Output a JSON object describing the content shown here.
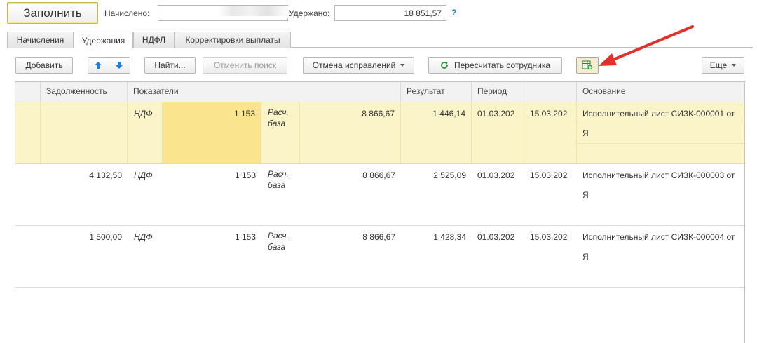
{
  "top": {
    "fill_button": "Заполнить",
    "accrued_label": "Начислено:",
    "accrued_value": "",
    "withheld_label": "Удержано:",
    "withheld_value": "18 851,57",
    "help_mark": "?"
  },
  "tabs": [
    {
      "label": "Начисления",
      "active": false
    },
    {
      "label": "Удержания",
      "active": true
    },
    {
      "label": "НДФЛ",
      "active": false
    },
    {
      "label": "Корректировки выплаты",
      "active": false
    }
  ],
  "toolbar": {
    "add": "Добавить",
    "find": "Найти...",
    "cancel_search": "Отменить поиск",
    "cancel_corrections": "Отмена исправлений",
    "recalc": "Пересчитать сотрудника",
    "more": "Еще"
  },
  "grid": {
    "columns": [
      "Задолженность",
      "Показатели",
      "Результат",
      "Период",
      "",
      "Основание"
    ],
    "rows": [
      {
        "debt": "",
        "ind_name": "НДФ",
        "ind_value": "1 153",
        "ind_name2": "Расч. база",
        "ind_value2": "8 866,67",
        "result": "1 446,14",
        "period_from": "01.03.202",
        "period_to": "15.03.202",
        "basis": "Исполнительный лист СИЗК-000001 от",
        "basis2": "Я"
      },
      {
        "debt": "4 132,50",
        "ind_name": "НДФ",
        "ind_value": "1 153",
        "ind_name2": "Расч. база",
        "ind_value2": "8 866,67",
        "result": "2 525,09",
        "period_from": "01.03.202",
        "period_to": "15.03.202",
        "basis": "Исполнительный лист СИЗК-000003 от",
        "basis2": "Я"
      },
      {
        "debt": "1 500,00",
        "ind_name": "НДФ",
        "ind_value": "1 153",
        "ind_name2": "Расч. база",
        "ind_value2": "8 866,67",
        "result": "1 428,34",
        "period_from": "01.03.202",
        "period_to": "15.03.202",
        "basis": "Исполнительный лист СИЗК-000004 от",
        "basis2": "Я"
      }
    ]
  },
  "colors": {
    "selected_row": "#fcf4c9",
    "selected_cell": "#fbe48e",
    "arrow": "#e0312b",
    "blue_icon": "#1e7fd6",
    "green_icon": "#2e9a3a"
  },
  "icons": [
    "arrow-up-icon",
    "arrow-down-icon",
    "refresh-icon",
    "table-add-icon",
    "dropdown-icon",
    "annotation-arrow"
  ]
}
